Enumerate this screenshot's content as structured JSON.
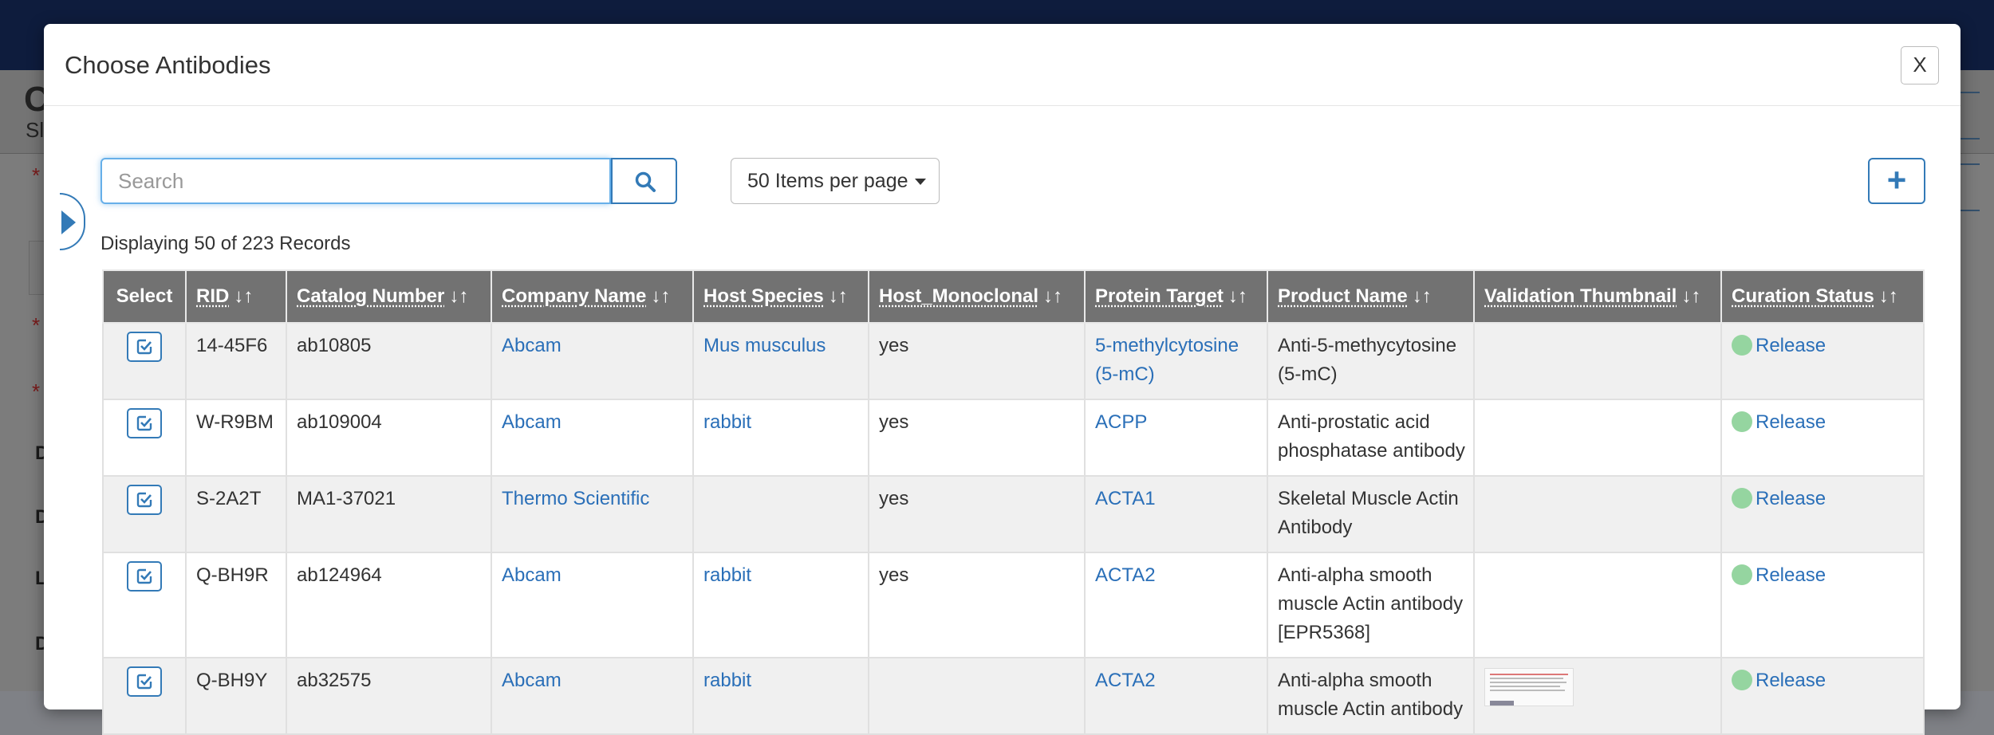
{
  "modal": {
    "title": "Choose Antibodies",
    "close_label": "X"
  },
  "toolbar": {
    "search_placeholder": "Search",
    "per_page_label": "50 Items per page",
    "add_label": "+"
  },
  "record_count": "Displaying 50 of 223 Records",
  "table": {
    "columns": [
      "Select",
      "RID",
      "Catalog Number",
      "Company Name",
      "Host Species",
      "Host_Monoclonal",
      "Protein Target",
      "Product Name",
      "Validation Thumbnail",
      "Curation Status"
    ],
    "rows": [
      {
        "rid": "14-45F6",
        "catalog": "ab10805",
        "company": "Abcam",
        "host": "Mus musculus",
        "monoclonal": "yes",
        "target": "5-methylcytosine (5-mC)",
        "product": "Anti-5-methycytosine (5-mC)",
        "thumbnail": false,
        "status": "Release"
      },
      {
        "rid": "W-R9BM",
        "catalog": "ab109004",
        "company": "Abcam",
        "host": "rabbit",
        "monoclonal": "yes",
        "target": "ACPP",
        "product": "Anti-prostatic acid phosphatase antibody",
        "thumbnail": false,
        "status": "Release"
      },
      {
        "rid": "S-2A2T",
        "catalog": "MA1-37021",
        "company": "Thermo Scientific",
        "host": "",
        "monoclonal": "yes",
        "target": "ACTA1",
        "product": "Skeletal Muscle Actin Antibody",
        "thumbnail": false,
        "status": "Release"
      },
      {
        "rid": "Q-BH9R",
        "catalog": "ab124964",
        "company": "Abcam",
        "host": "rabbit",
        "monoclonal": "yes",
        "target": "ACTA2",
        "product": "Anti-alpha smooth muscle Actin antibody [EPR5368]",
        "thumbnail": false,
        "status": "Release"
      },
      {
        "rid": "Q-BH9Y",
        "catalog": "ab32575",
        "company": "Abcam",
        "host": "rabbit",
        "monoclonal": "",
        "target": "ACTA2",
        "product": "Anti-alpha smooth muscle Actin antibody",
        "thumbnail": true,
        "status": "Release"
      }
    ]
  },
  "background_page": {
    "title": "C",
    "subtitle": "Sl",
    "labels": [
      "D",
      "D",
      "L",
      "D"
    ]
  },
  "colors": {
    "accent": "#337ab7",
    "link": "#2a6fb8",
    "header_bg": "#727272",
    "status_release": "#95d5a0",
    "topbar": "#0e1c3d"
  }
}
